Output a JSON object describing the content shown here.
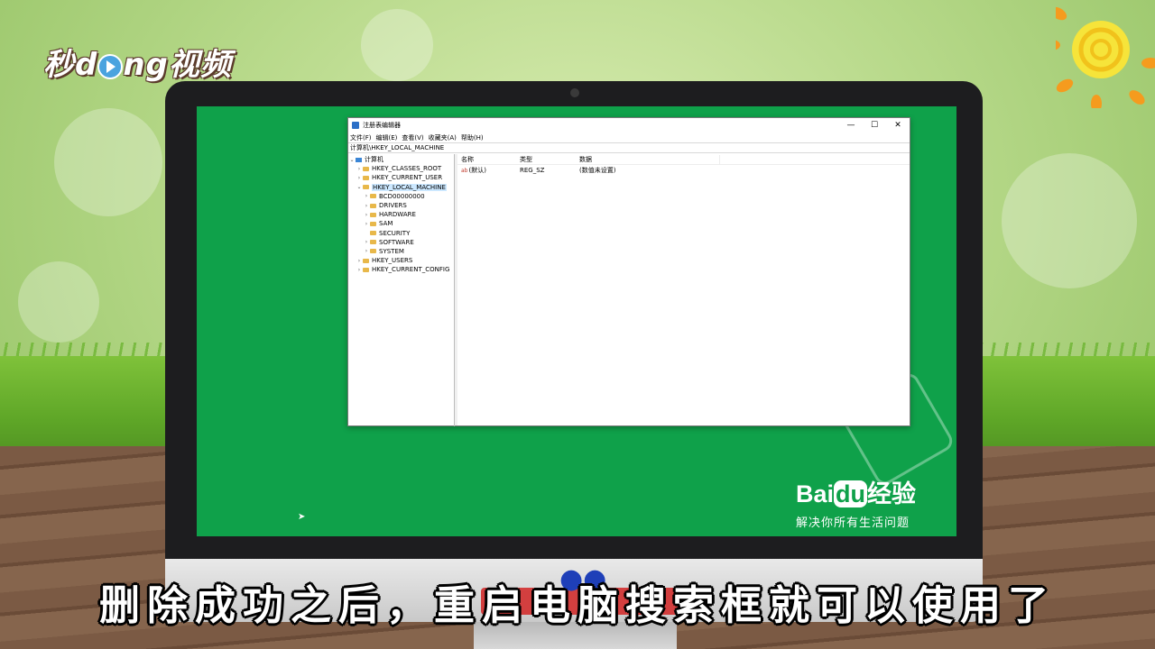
{
  "watermark": {
    "prefix": "秒",
    "d": "d",
    "suffix": "ng视频"
  },
  "window": {
    "title": "注册表编辑器",
    "controls": {
      "minimize": "—",
      "maximize": "☐",
      "close": "✕"
    },
    "menu": [
      "文件(F)",
      "编辑(E)",
      "查看(V)",
      "收藏夹(A)",
      "帮助(H)"
    ],
    "address": "计算机\\HKEY_LOCAL_MACHINE",
    "tree": [
      {
        "label": "计算机",
        "level": 0,
        "expanded": true
      },
      {
        "label": "HKEY_CLASSES_ROOT",
        "level": 1
      },
      {
        "label": "HKEY_CURRENT_USER",
        "level": 1
      },
      {
        "label": "HKEY_LOCAL_MACHINE",
        "level": 1,
        "expanded": true,
        "selected": true
      },
      {
        "label": "BCD00000000",
        "level": 2
      },
      {
        "label": "DRIVERS",
        "level": 2
      },
      {
        "label": "HARDWARE",
        "level": 2
      },
      {
        "label": "SAM",
        "level": 2
      },
      {
        "label": "SECURITY",
        "level": 2
      },
      {
        "label": "SOFTWARE",
        "level": 2
      },
      {
        "label": "SYSTEM",
        "level": 2
      },
      {
        "label": "HKEY_USERS",
        "level": 1
      },
      {
        "label": "HKEY_CURRENT_CONFIG",
        "level": 1
      }
    ],
    "list": {
      "headers": [
        "名称",
        "类型",
        "数据"
      ],
      "rows": [
        {
          "icon": "ab",
          "name": "(默认)",
          "type": "REG_SZ",
          "data": "(数值未设置)"
        }
      ]
    }
  },
  "baidu": {
    "brand_a": "Bai",
    "brand_b": "du",
    "brand_c": "经验",
    "slogan": "解决你所有生活问题"
  },
  "subtitle": "删除成功之后，重启电脑搜索框就可以使用了"
}
